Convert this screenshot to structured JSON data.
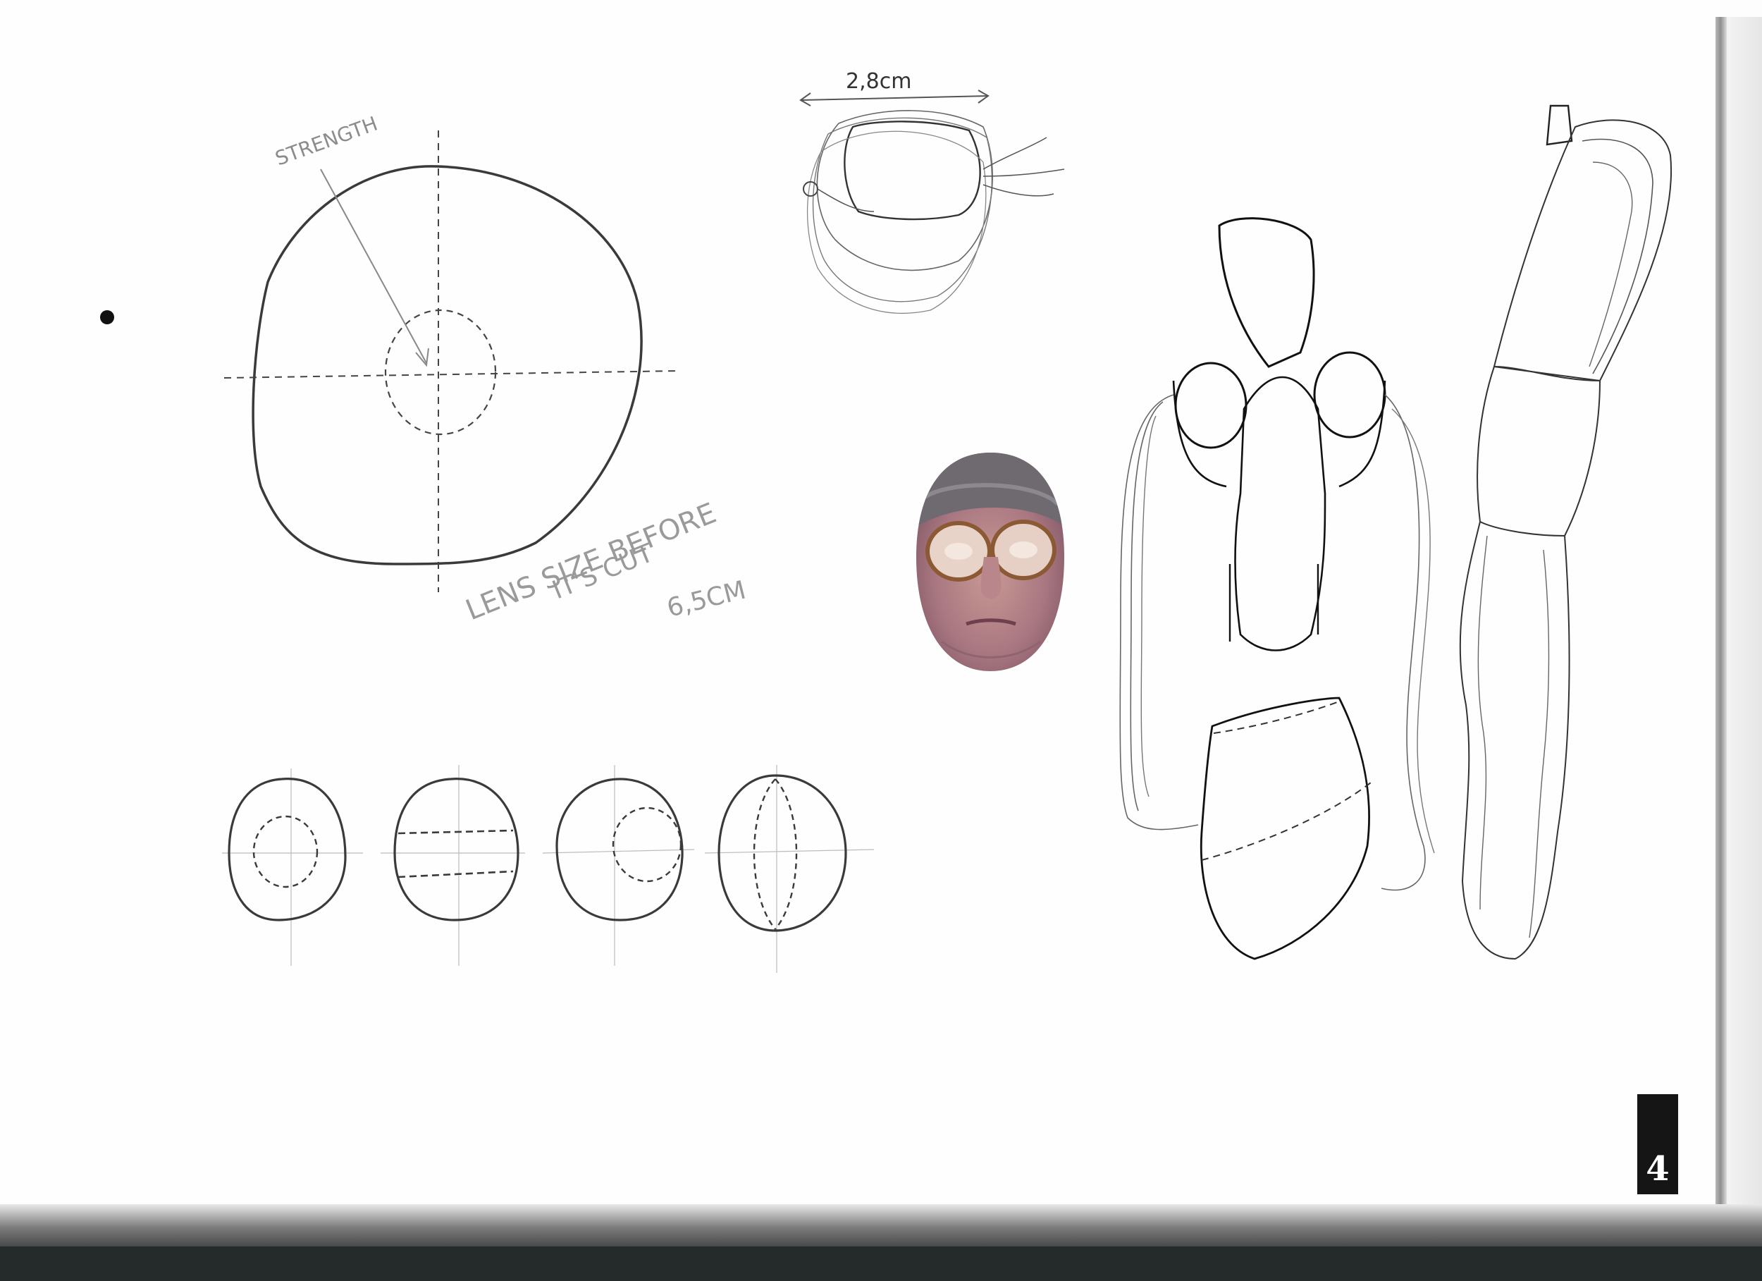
{
  "sketchbook_page": {
    "annotations": {
      "strength_label": "STRENGTH",
      "width_label": "2,8cm",
      "lens_size_line1": "LENS SIZE BEFORE",
      "lens_size_line2": "IT'S CUT",
      "diameter_label": "6,5CM"
    },
    "page_number": "4"
  }
}
